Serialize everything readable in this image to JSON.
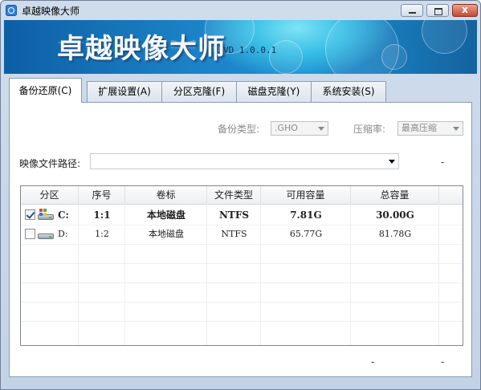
{
  "window": {
    "title": "卓越映像大师",
    "close_glyph": "x"
  },
  "banner": {
    "product_name": "卓越映像大师",
    "version": "VD 1.0.0.1"
  },
  "tabs": [
    {
      "label": "备份还原",
      "hotkey": "(C)",
      "active": true
    },
    {
      "label": "扩展设置",
      "hotkey": "(A)",
      "active": false
    },
    {
      "label": "分区克隆",
      "hotkey": "(F)",
      "active": false
    },
    {
      "label": "磁盘克隆",
      "hotkey": "(Y)",
      "active": false
    },
    {
      "label": "系统安装",
      "hotkey": "(S)",
      "active": false
    }
  ],
  "options": {
    "backup_type_label": "备份类型:",
    "backup_type_value": ".GHO",
    "compression_label": "压缩率:",
    "compression_value": "最高压缩"
  },
  "image_path": {
    "label": "映像文件路径:",
    "value": "",
    "side_text": "-"
  },
  "table": {
    "columns": [
      "分区",
      "序号",
      "卷标",
      "文件类型",
      "可用容量",
      "总容量"
    ],
    "rows": [
      {
        "checked": true,
        "drive": "C:",
        "index": "1:1",
        "label": "本地磁盘",
        "fs": "NTFS",
        "free": "7.81G",
        "total": "30.00G",
        "system": true
      },
      {
        "checked": false,
        "drive": "D:",
        "index": "1:2",
        "label": "本地磁盘",
        "fs": "NTFS",
        "free": "65.77G",
        "total": "81.78G",
        "system": false
      }
    ]
  },
  "footer": {
    "status_left": "-",
    "status_right": "-"
  },
  "colors": {
    "banner_dark": "#0e5fa5",
    "banner_light": "#39bfe6",
    "close_button": "#c74a33"
  }
}
